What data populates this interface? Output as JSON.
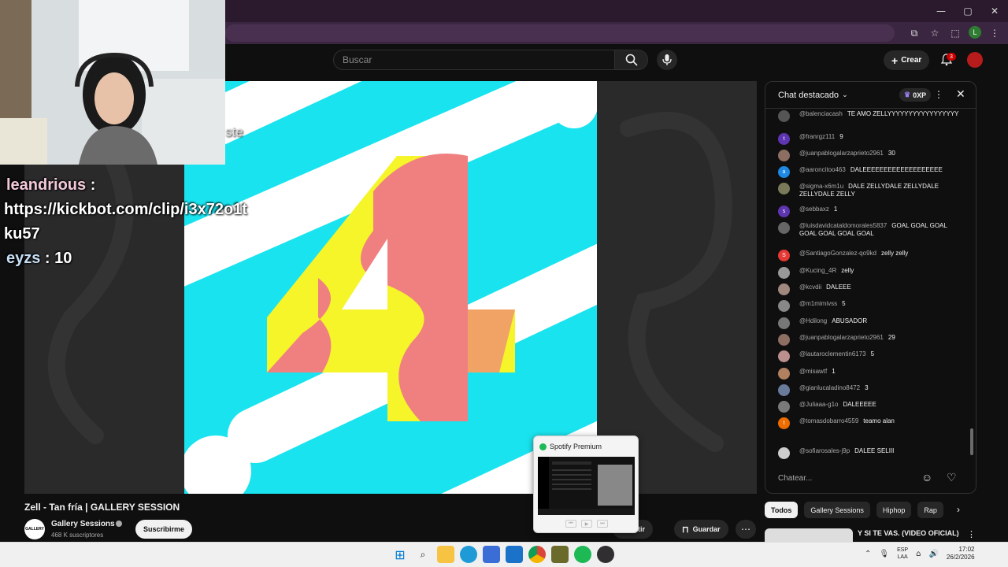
{
  "browser": {
    "window_controls": {
      "minimize": "—",
      "maximize": "▢",
      "close": "✕"
    },
    "profile_initial": "L"
  },
  "youtube": {
    "search_placeholder": "Buscar",
    "create_label": "Crear",
    "notifications_count": "3"
  },
  "overlay": {
    "bot_lines": [
      {
        "user": "leandrious",
        "sep": " :"
      },
      {
        "text": "https://kickbot.com/clip/i3x72o1t"
      },
      {
        "text": "ku57"
      },
      {
        "user": "eyzs",
        "sep": " : 10"
      }
    ],
    "partial_text": "ste"
  },
  "chat": {
    "title": "Chat destacado",
    "xp_label": "0XP",
    "input_placeholder": "Chatear...",
    "messages": [
      {
        "user": "@balenciacash",
        "text": "TE AMO ZELLYYYYYYYYYYYYYYYYY",
        "avatar_color": "#555",
        "initial": ""
      },
      {
        "user": "@franrgz111",
        "text": "9",
        "avatar_color": "#5e35b1",
        "initial": "t"
      },
      {
        "user": "@juanpablogalarzaprieto2961",
        "text": "30",
        "avatar_color": "#8d6e63",
        "initial": ""
      },
      {
        "user": "@aaroncitoo463",
        "text": "DALEEEEEEEEEEEEEEEEEEE",
        "avatar_color": "#1e88e5",
        "initial": "a"
      },
      {
        "user": "@sigma-x6m1u",
        "text": "DALE ZELLYDALE ZELLYDALE ZELLYDALE ZELLY",
        "avatar_color": "#7a7a5a",
        "initial": ""
      },
      {
        "user": "@sebbaxz",
        "text": "1",
        "avatar_color": "#5e35b1",
        "initial": "s"
      },
      {
        "user": "@luisdavidcataldomorales5837",
        "text": "GOAL GOAL GOAL GOAL GOAL GOAL GOAL",
        "avatar_color": "#666",
        "initial": ""
      },
      {
        "user": "@SantiagoGonzalez-qo9kd",
        "text": "zelly zelly",
        "avatar_color": "#e53935",
        "initial": "S"
      },
      {
        "user": "@Kucing_4R",
        "text": "zelly",
        "avatar_color": "#999",
        "initial": ""
      },
      {
        "user": "@kcvdii",
        "text": "DALEEE",
        "avatar_color": "#a1887f",
        "initial": ""
      },
      {
        "user": "@m1mimivss",
        "text": "5",
        "avatar_color": "#888",
        "initial": ""
      },
      {
        "user": "@Hdilong",
        "text": "ABUSADOR",
        "avatar_color": "#777",
        "initial": ""
      },
      {
        "user": "@juanpablogalarzaprieto2961",
        "text": "29",
        "avatar_color": "#8d6e63",
        "initial": ""
      },
      {
        "user": "@lautaroclementin6173",
        "text": "5",
        "avatar_color": "#bc8f8f",
        "initial": ""
      },
      {
        "user": "@misawtf",
        "text": "1",
        "avatar_color": "#b08060",
        "initial": ""
      },
      {
        "user": "@gianlucaladino8472",
        "text": "3",
        "avatar_color": "#6a7a9a",
        "initial": ""
      },
      {
        "user": "@Juliaaa-g1o",
        "text": "DALEEEEE",
        "avatar_color": "#7a7a7a",
        "initial": ""
      },
      {
        "user": "@tomasdobarro4559",
        "text": "teamo alan",
        "avatar_color": "#ef6c00",
        "initial": "t"
      },
      {
        "user": "@sofiarosales-j9p",
        "text": "DALEE SELIII",
        "avatar_color": "#ccc",
        "initial": ""
      }
    ]
  },
  "video": {
    "title": "Zell - Tan fría | GALLERY SESSION",
    "channel_name": "Gallery Sessions",
    "channel_avatar_text": "GALLERY",
    "subscribers": "468 K suscriptores",
    "subscribe_label": "Suscribirme",
    "share_label": "mpartir",
    "save_label": "Guardar"
  },
  "chips": [
    "Todos",
    "Gallery Sessions",
    "Hiphop",
    "Rap"
  ],
  "recommendation": {
    "title": "Y SI TE VAS. (VIDEO OFICIAL)"
  },
  "spotify_preview": {
    "title": "Spotify Premium"
  },
  "taskbar": {
    "lang_top": "ESP",
    "lang_bottom": "LAA",
    "time": "17:02",
    "date": "26/2/2026"
  },
  "colors": {
    "art_background": "#19e3ee",
    "art_yellow": "#f5f52a",
    "art_pink": "#f08080",
    "accent_red": "#cc0000"
  }
}
